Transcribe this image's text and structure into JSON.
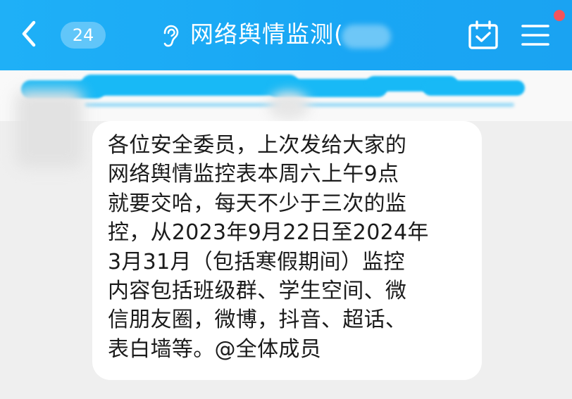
{
  "header": {
    "back_icon": "chevron-left-icon",
    "unread_count": "24",
    "listen_icon": "ear-icon",
    "title": "网络舆情监测(",
    "calendar_icon": "calendar-check-icon",
    "menu_icon": "hamburger-menu-icon",
    "notification_dot_color": "#f2545b",
    "accent_color": "#1aa9f4"
  },
  "message": {
    "text": "各位安全委员，上次发给大家的\n网络舆情监控表本周六上午9点\n就要交哈，每天不少于三次的监\n控，从2023年9月22日至2024年\n3月31月（包括寒假期间）监控\n内容包括班级群、学生空间、微\n信朋友圈，微博，抖音、超话、\n表白墙等。@全体成员"
  }
}
